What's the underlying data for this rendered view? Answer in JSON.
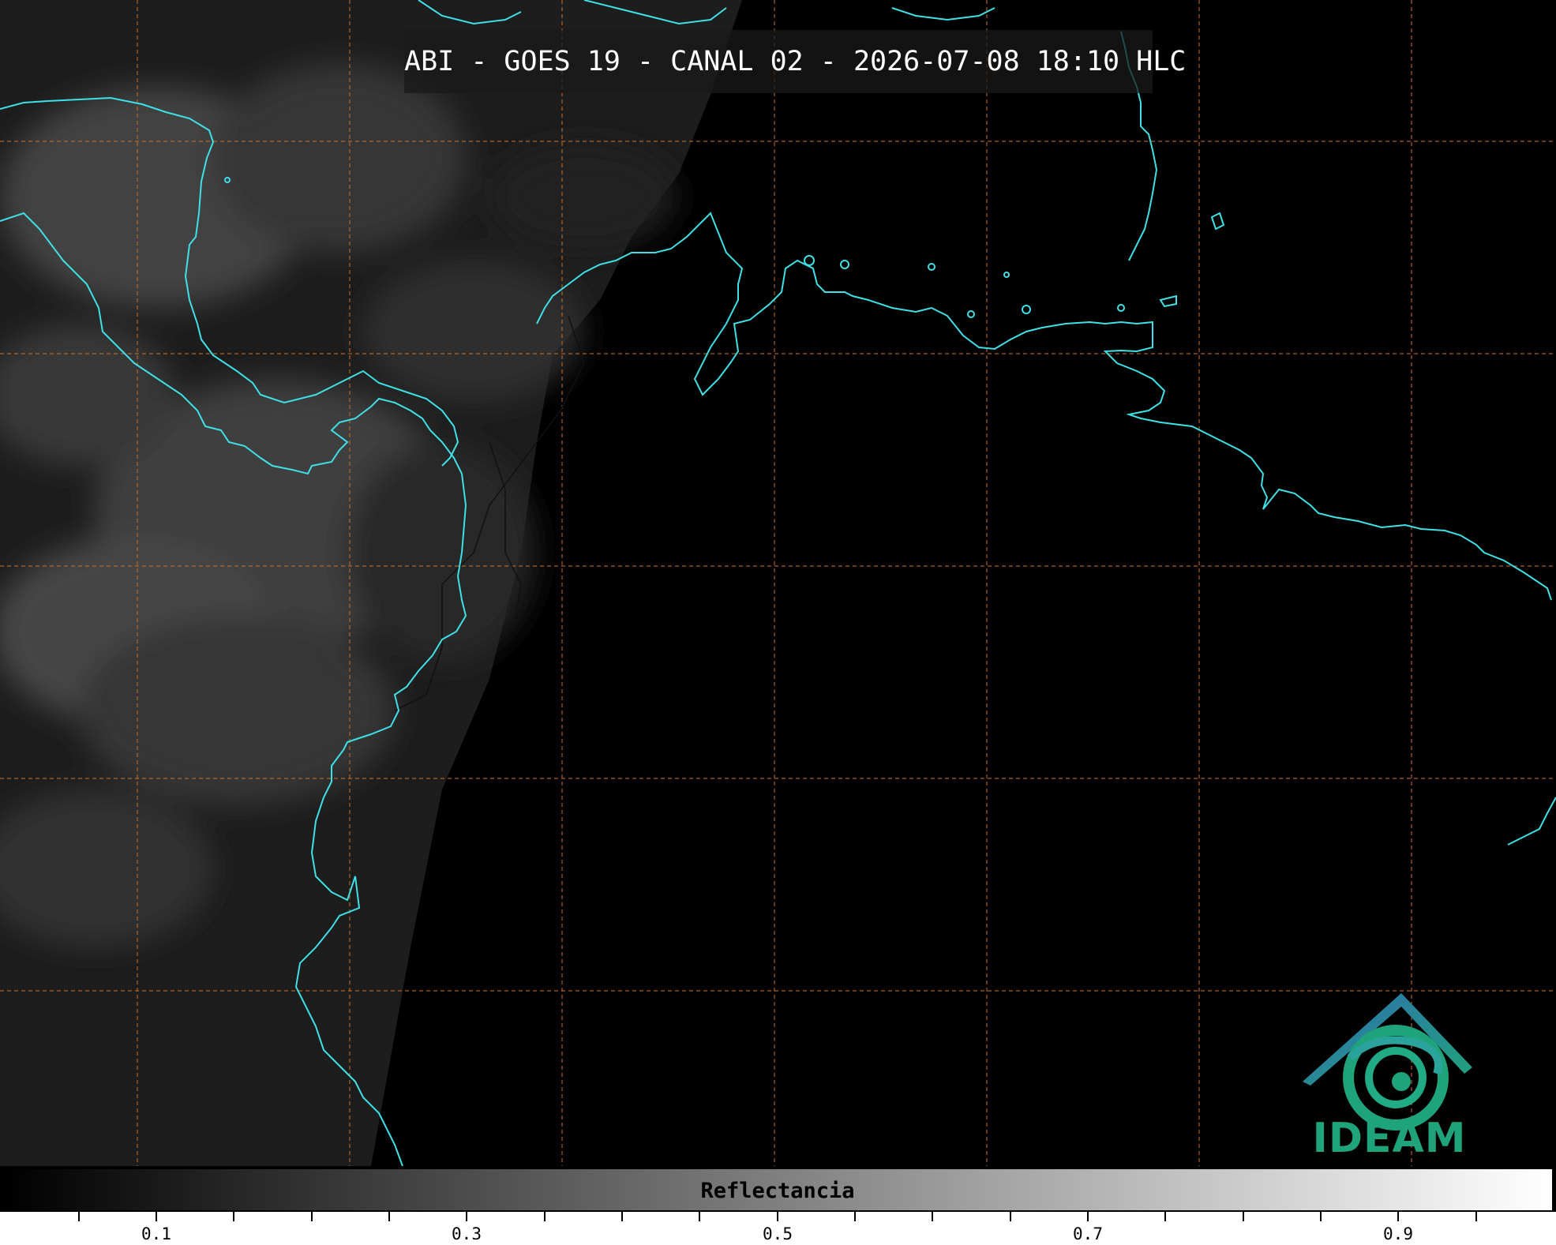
{
  "title": "ABI - GOES 19 - CANAL 02 - 2026-07-08 18:10 HLC",
  "colorbar": {
    "label": "Reflectancia",
    "tick_labels": [
      "0.1",
      "0.3",
      "0.5",
      "0.7",
      "0.9"
    ],
    "range": [
      0.0,
      1.0
    ],
    "colors": [
      "#000000",
      "#ffffff"
    ]
  },
  "logo": {
    "text": "IDEAM",
    "icon": "ideam-logo-icon",
    "colors": [
      "#2f6fb0",
      "#1fa37a"
    ]
  },
  "map": {
    "coastline_color": "#3fe0e6",
    "grid_color": "#c8702a",
    "grid_style": "dashed"
  }
}
